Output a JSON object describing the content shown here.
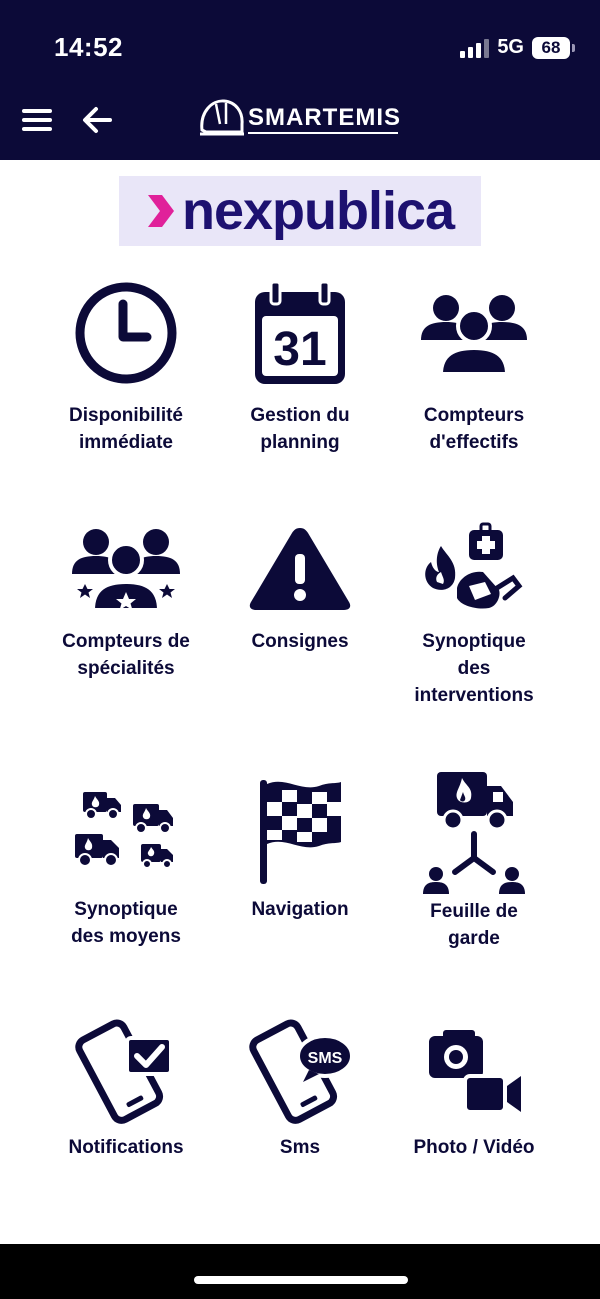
{
  "status_bar": {
    "time": "14:52",
    "network": "5G",
    "battery": "68"
  },
  "header": {
    "app_name": "SMARTEMIS",
    "menu_icon": "hamburger-menu-icon",
    "back_icon": "back-arrow-icon"
  },
  "brand": {
    "name": "nexpublica"
  },
  "colors": {
    "navy": "#0c0a38",
    "brand_pink": "#e0219a",
    "brand_bg": "#e9e6f8"
  },
  "menu": [
    {
      "label": "Disponibilité\nimmédiate",
      "icon": "clock-icon"
    },
    {
      "label": "Gestion du\nplanning",
      "icon": "calendar-icon",
      "icon_text": "31"
    },
    {
      "label": "Compteurs\nd'effectifs",
      "icon": "people-group-icon"
    },
    {
      "label": "Compteurs de\nspécialités",
      "icon": "people-stars-icon"
    },
    {
      "label": "Consignes",
      "icon": "warning-triangle-icon"
    },
    {
      "label": "Synoptique\ndes\ninterventions",
      "icon": "interventions-icon"
    },
    {
      "label": "Synoptique\ndes moyens",
      "icon": "trucks-fleet-icon"
    },
    {
      "label": "Navigation",
      "icon": "checkered-flag-icon"
    },
    {
      "label": "Feuille de\ngarde",
      "icon": "truck-network-icon"
    },
    {
      "label": "Notifications",
      "icon": "phone-check-icon"
    },
    {
      "label": "Sms",
      "icon": "phone-sms-icon",
      "icon_text": "SMS"
    },
    {
      "label": "Photo / Vidéo",
      "icon": "camera-video-icon"
    }
  ]
}
